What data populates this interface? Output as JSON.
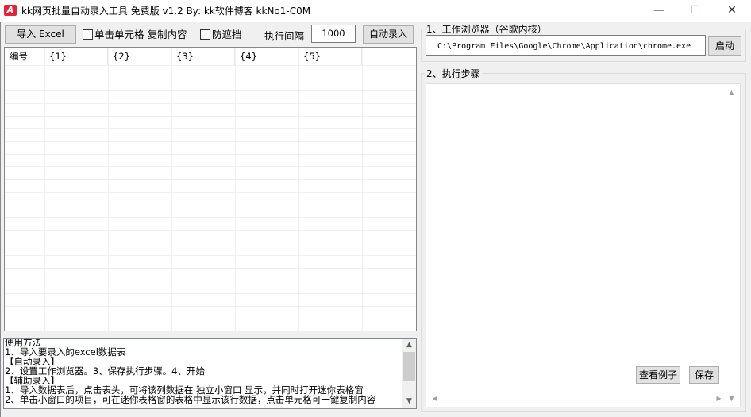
{
  "window": {
    "title": "kk网页批量自动录入工具 免费版  v1.2   By:  kk软件博客 kkNo1-C0M",
    "logo_text": "A",
    "minimize": "—",
    "maximize": "☐",
    "close": "✕"
  },
  "toolbar": {
    "import_label": "导入 Excel",
    "copy_cell_label": "单击单元格 复制内容",
    "anti_block_label": "防遮挡",
    "interval_label": "执行间隔",
    "interval_value": "1000",
    "auto_entry_label": "自动录入"
  },
  "grid": {
    "headers": [
      "编号",
      "{1}",
      "{2}",
      "{3}",
      "{4}",
      "{5}"
    ]
  },
  "usage": {
    "lines": [
      "使用方法",
      "1、导入要录入的excel数据表",
      "【自动录入】",
      "2、设置工作浏览器。3、保存执行步骤。4、开始",
      "【辅助录入】",
      "1、导入数据表后，点击表头，可将该列数据在 独立小窗口 显示，并同时打开迷你表格窗",
      "2、单击小窗口的项目，可在迷你表格窗的表格中显示该行数据，点击单元格可一键复制内容"
    ]
  },
  "browser": {
    "section_title": "1、工作浏览器（谷歌内核）",
    "path_value": "C:\\Program Files\\Google\\Chrome\\Application\\chrome.exe",
    "launch_label": "启动"
  },
  "steps": {
    "section_title": "2、执行步骤",
    "example_label": "查看例子",
    "save_label": "保存"
  }
}
